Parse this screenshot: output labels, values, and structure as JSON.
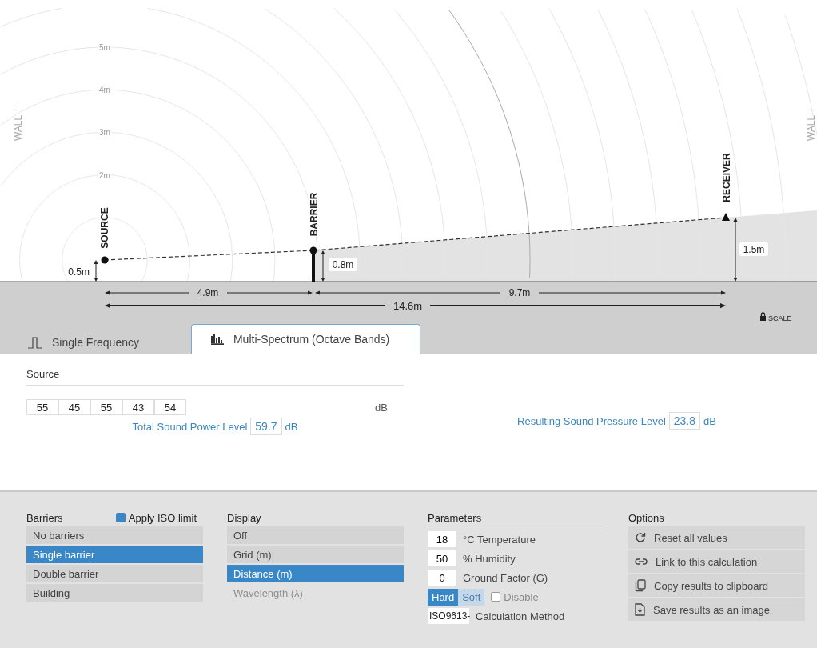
{
  "diagram": {
    "walls": [
      "WALL +",
      "WALL +"
    ],
    "rings": [
      "5m",
      "4m",
      "3m",
      "2m"
    ],
    "source": {
      "label": "SOURCE",
      "height": "0.5m"
    },
    "barrier": {
      "label": "BARRIER",
      "height": "0.8m"
    },
    "receiver": {
      "label": "RECEIVER",
      "height": "1.5m"
    },
    "distances": {
      "source_to_barrier": "4.9m",
      "barrier_to_receiver": "9.7m",
      "total": "14.6m"
    },
    "scale": "SCALE"
  },
  "tabs": [
    {
      "label": "Single Frequency",
      "kind": "pulse",
      "selected": false
    },
    {
      "label": "Multi-Spectrum (Octave Bands)",
      "kind": "bars",
      "selected": true
    }
  ],
  "source": {
    "title": "Source",
    "bands": [
      "55",
      "45",
      "55",
      "43",
      "54"
    ],
    "unit": "dB",
    "total": {
      "label": "Total Sound Power Level",
      "value": "59.7",
      "unit": "dB"
    }
  },
  "result": {
    "label": "Resulting Sound Pressure Level",
    "value": "23.8",
    "unit": "dB"
  },
  "barriers": {
    "title": "Barriers",
    "iso_limit": {
      "label": "Apply ISO limit",
      "checked": true
    },
    "items": [
      {
        "label": "No barriers",
        "selected": false
      },
      {
        "label": "Single barrier",
        "selected": true
      },
      {
        "label": "Double barrier",
        "selected": false
      },
      {
        "label": "Building",
        "selected": false
      }
    ]
  },
  "display": {
    "title": "Display",
    "items": [
      {
        "label": "Off",
        "selected": false,
        "disabled": false
      },
      {
        "label": "Grid (m)",
        "selected": false,
        "disabled": false
      },
      {
        "label": "Distance (m)",
        "selected": true,
        "disabled": false
      },
      {
        "label": "Wavelength (λ)",
        "selected": false,
        "disabled": true
      }
    ]
  },
  "parameters": {
    "title": "Parameters",
    "fields": [
      {
        "value": "18",
        "label": "°C Temperature"
      },
      {
        "value": "50",
        "label": "% Humidity"
      },
      {
        "value": "0",
        "label": "Ground Factor (G)"
      }
    ],
    "ground": [
      {
        "label": "Hard",
        "selected": true
      },
      {
        "label": "Soft",
        "selected": false
      }
    ],
    "disable": {
      "label": "Disable",
      "checked": false
    },
    "method": {
      "value": "ISO9613-",
      "label": "Calculation Method"
    }
  },
  "options": {
    "title": "Options",
    "items": [
      {
        "label": "Reset all values",
        "kind": "reset"
      },
      {
        "label": "Link to this calculation",
        "kind": "link"
      },
      {
        "label": "Copy results to clipboard",
        "kind": "copy"
      },
      {
        "label": "Save results as an image",
        "kind": "save"
      }
    ]
  }
}
